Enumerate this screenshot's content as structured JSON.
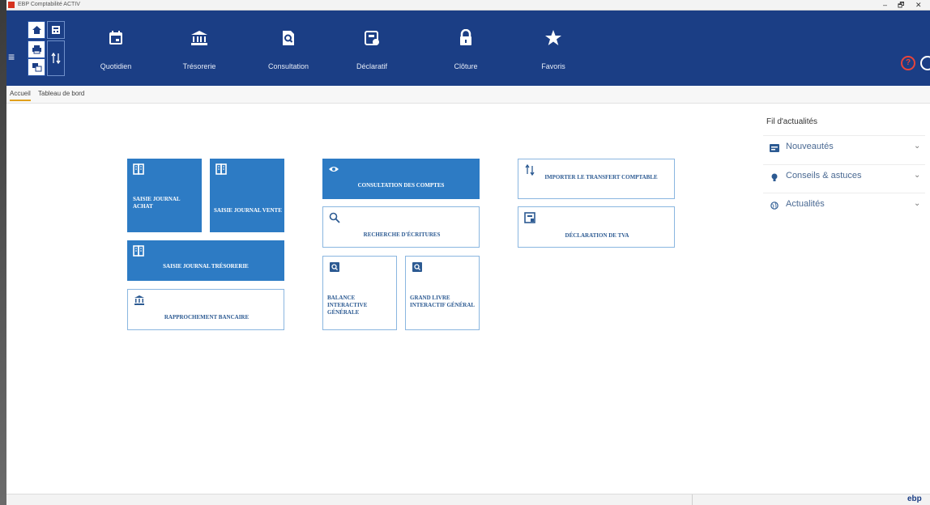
{
  "app": {
    "title": "EBP Comptabilité ACTIV",
    "window_controls": [
      "‒",
      "🗗",
      "✕"
    ]
  },
  "ribbon": {
    "nav": [
      {
        "label": "Quotidien",
        "icon": "calendar-icon"
      },
      {
        "label": "Trésorerie",
        "icon": "bank-icon"
      },
      {
        "label": "Consultation",
        "icon": "search-doc-icon"
      },
      {
        "label": "Déclaratif",
        "icon": "declaration-icon"
      },
      {
        "label": "Clôture",
        "icon": "lock-icon"
      },
      {
        "label": "Favoris",
        "icon": "star-icon"
      }
    ],
    "help_glyph": "?"
  },
  "tabs": [
    {
      "label": "Accueil",
      "active": true
    },
    {
      "label": "Tableau de bord",
      "active": false
    }
  ],
  "tiles": {
    "saisie_achat": "SAISIE JOURNAL ACHAT",
    "saisie_vente": "SAISIE JOURNAL VENTE",
    "saisie_tresorerie": "SAISIE JOURNAL TRÉSORERIE",
    "rapprochement": "RAPPROCHEMENT BANCAIRE",
    "consultation_comptes": "CONSULTATION DES COMPTES",
    "recherche_ecritures": "RECHERCHE D'ÉCRITURES",
    "balance": "BALANCE INTERACTIVE GÉNÉRALE",
    "grand_livre": "GRAND LIVRE INTERACTIF GÉNÉRAL",
    "importer": "IMPORTER LE TRANSFERT COMPTABLE",
    "declaration_tva": "DÉCLARATION DE TVA"
  },
  "news": {
    "title": "Fil d'actualités",
    "items": [
      {
        "label": "Nouveautés",
        "icon": "news-icon"
      },
      {
        "label": "Conseils & astuces",
        "icon": "bulb-icon"
      },
      {
        "label": "Actualités",
        "icon": "globe-icon"
      }
    ]
  },
  "footer": {
    "brand": "ebp"
  },
  "colors": {
    "ribbon": "#1b3e85",
    "tile_blue": "#2d7bc4",
    "tab_accent": "#e1a01c"
  }
}
